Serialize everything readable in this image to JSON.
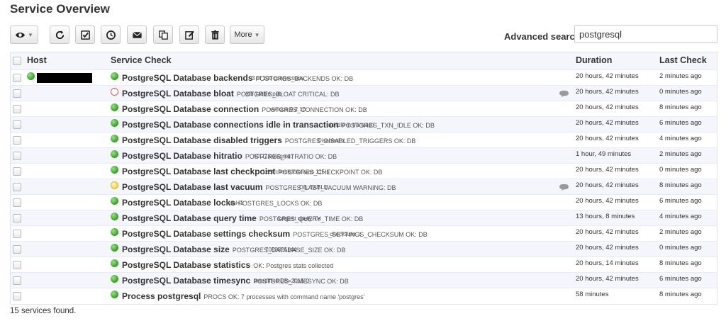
{
  "page": {
    "title": "Service Overview"
  },
  "toolbar": {
    "more_label": "More"
  },
  "search": {
    "label": "Advanced search",
    "value": "postgresql"
  },
  "table": {
    "headers": {
      "host": "Host",
      "service": "Service Check",
      "duration": "Duration",
      "last_check": "Last Check"
    }
  },
  "rows": [
    {
      "status": "ok",
      "name": "PostgreSQL Database backends",
      "state": "POSTGRES_BACKENDS OK: DB",
      "info": "3 of 100 connections",
      "comment": false,
      "duration": "20 hours, 42 minutes",
      "last_check": "2 minutes ago"
    },
    {
      "status": "crit",
      "name": "PostgreSQL Database bloat",
      "state": "POSTGRES_BLOAT CRITICAL: DB",
      "info": "(db    ) table pub",
      "comment": true,
      "duration": "20 hours, 42 minutes",
      "last_check": "0 minutes ago"
    },
    {
      "status": "ok",
      "name": "PostgreSQL Database connection",
      "state": "POSTGRES_CONNECTION OK: DB",
      "info": "version 9.2.10",
      "comment": false,
      "duration": "20 hours, 42 minutes",
      "last_check": "8 minutes ago"
    },
    {
      "status": "ok",
      "name": "PostgreSQL Database connections idle in transaction",
      "state": "POSTGRES_TXN_IDLE OK: DB",
      "info": "no idle in transacti",
      "comment": false,
      "duration": "20 hours, 42 minutes",
      "last_check": "6 minutes ago"
    },
    {
      "status": "ok",
      "name": "PostgreSQL Database disabled triggers",
      "state": "POSTGRES_DISABLED_TRIGGERS OK: DB",
      "info": "Disabled tr",
      "comment": false,
      "duration": "20 hours, 42 minutes",
      "last_check": "4 minutes ago"
    },
    {
      "status": "ok",
      "name": "PostgreSQL Database hitratio",
      "state": "POSTGRES_HITRATIO OK: DB",
      "info": "40.27 postgres:",
      "comment": false,
      "duration": "1 hour, 49 minutes",
      "last_check": "2 minutes ago"
    },
    {
      "status": "ok",
      "name": "PostgreSQL Database last checkpoint",
      "state": "POSTGRES_CHECKPOINT OK: DB",
      "info": "Last checkpoint was 115 s",
      "comment": false,
      "duration": "20 hours, 42 minutes",
      "last_check": "0 minutes ago"
    },
    {
      "status": "warn",
      "name": "PostgreSQL Database last vacuum",
      "state": "POSTGRES_LAST_VACUUM WARNING: DB",
      "info": "DB:      TABLE",
      "comment": true,
      "duration": "20 hours, 42 minutes",
      "last_check": "8 minutes ago"
    },
    {
      "status": "ok",
      "name": "PostgreSQL Database locks",
      "state": "POSTGRES_LOCKS OK: DB",
      "info": "total=1",
      "comment": false,
      "duration": "20 hours, 42 minutes",
      "last_check": "6 minutes ago"
    },
    {
      "status": "ok",
      "name": "PostgreSQL Database query time",
      "state": "POSTGRES_QUERY_TIME OK: DB",
      "info": "longest query: 0s",
      "comment": false,
      "duration": "13 hours, 8 minutes",
      "last_check": "4 minutes ago"
    },
    {
      "status": "ok",
      "name": "PostgreSQL Database settings checksum",
      "state": "POSTGRES_SETTINGS_CHECKSUM OK: DB",
      "info": "checksum: c",
      "comment": false,
      "duration": "20 hours, 42 minutes",
      "last_check": "2 minutes ago"
    },
    {
      "status": "ok",
      "name": "PostgreSQL Database size",
      "state": "POSTGRES_DATABASE_SIZE OK: DB",
      "info": "7053825144",
      "comment": false,
      "duration": "20 hours, 42 minutes",
      "last_check": "0 minutes ago"
    },
    {
      "status": "ok",
      "name": "PostgreSQL Database statistics",
      "state": "OK: Postgres stats collected",
      "info": "",
      "comment": false,
      "duration": "20 hours, 14 minutes",
      "last_check": "8 minutes ago"
    },
    {
      "status": "ok",
      "name": "PostgreSQL Database timesync",
      "state": "POSTGRES_TIMESYNC OK: DB",
      "info": "timediff=0 DB=2015-0",
      "comment": false,
      "duration": "20 hours, 42 minutes",
      "last_check": "6 minutes ago"
    },
    {
      "status": "ok",
      "name": "Process postgresql",
      "state": "PROCS OK: 7 processes with command name 'postgres'",
      "info": "",
      "comment": false,
      "duration": "58 minutes",
      "last_check": "8 minutes ago"
    }
  ],
  "footer": {
    "count_text": "15 services found."
  },
  "colors": {
    "ok": "#3fa92e",
    "critical": "#e05a5a",
    "warning": "#f2d64a",
    "row_alt": "#f4f6fc"
  },
  "icons": [
    "eye-icon",
    "refresh-icon",
    "check-icon",
    "clock-icon",
    "envelope-icon",
    "copy-icon",
    "edit-icon",
    "trash-icon",
    "comment-icon"
  ]
}
